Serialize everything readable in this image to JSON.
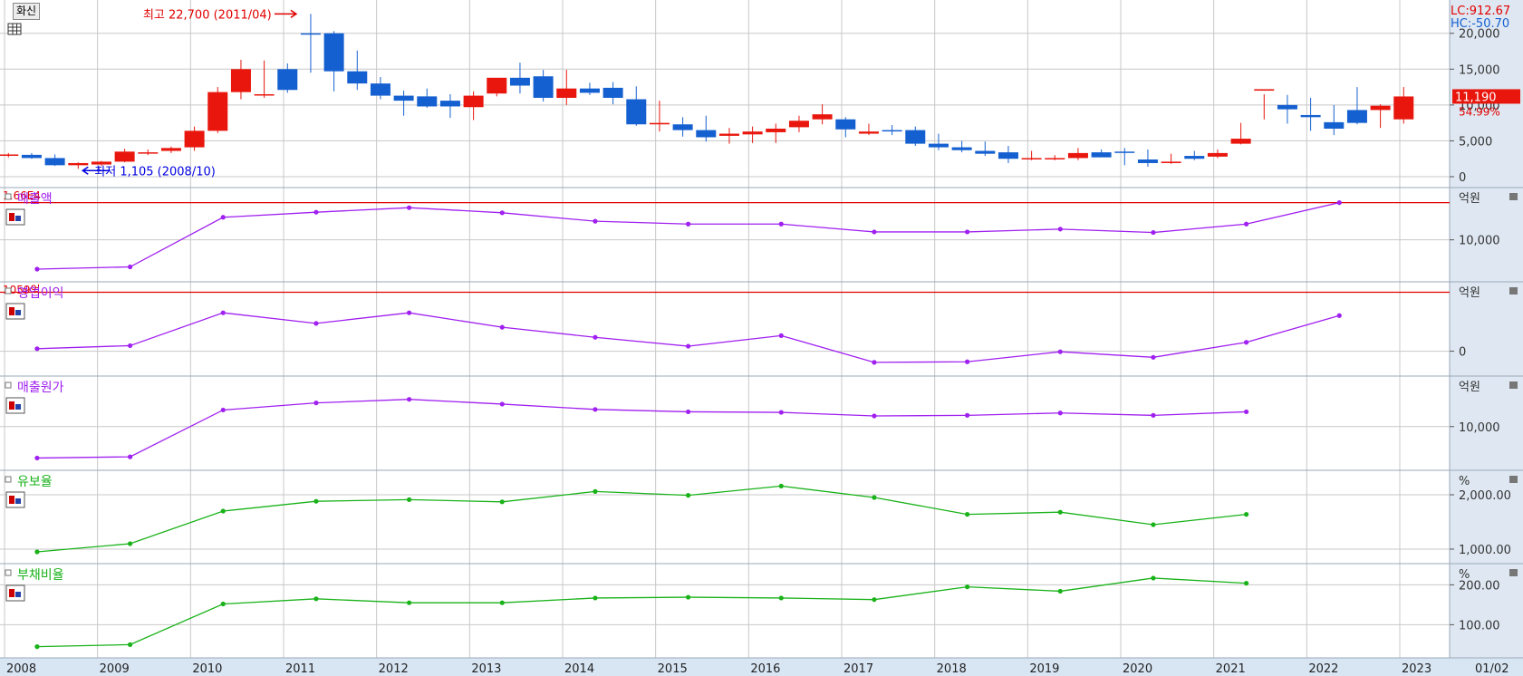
{
  "toolbar": {
    "title": "화신"
  },
  "x_axis": {
    "labels": [
      "2008",
      "2009",
      "2010",
      "2011",
      "2012",
      "2013",
      "2014",
      "2015",
      "2016",
      "2017",
      "2018",
      "2019",
      "2020",
      "2021",
      "2022",
      "2023"
    ],
    "end_label": "01/02"
  },
  "price_panel": {
    "lc_label": "LC:912.67",
    "hc_label": "HC:-50.70",
    "high_annotation": "최고 22,700 (2011/04)",
    "low_annotation": "최저 1,105 (2008/10)",
    "current_price": "11,190",
    "current_pct": "54.99%",
    "y_ticks": [
      "20,000",
      "15,000",
      "10,000",
      "5,000",
      "0"
    ]
  },
  "panels": [
    {
      "id": "sales",
      "title": "매출액",
      "unit": "억원",
      "ref_label": "1.66E4",
      "ticks": [
        "10,000"
      ],
      "color": "#a020f0"
    },
    {
      "id": "op_income",
      "title": "영업이익",
      "unit": "억원",
      "ref_label": "1059억",
      "ticks": [
        "0"
      ],
      "color": "#a020f0"
    },
    {
      "id": "cogs",
      "title": "매출원가",
      "unit": "억원",
      "ticks": [
        "10,000"
      ],
      "color": "#a020f0"
    },
    {
      "id": "retention",
      "title": "유보율",
      "unit": "%",
      "ticks": [
        "2,000.00",
        "1,000.00"
      ],
      "color": "#19b219"
    },
    {
      "id": "debt",
      "title": "부채비율",
      "unit": "%",
      "ticks": [
        "200.00",
        "100.00"
      ],
      "color": "#19b219"
    }
  ],
  "colors": {
    "up": "#e8160c",
    "down": "#1560d0",
    "grid": "#c8c8c8",
    "axis_bg": "#d8e6f4",
    "ref_line": "#e00000",
    "purple": "#a020f0",
    "green": "#19b219"
  },
  "chart_data": [
    {
      "type": "candlestick",
      "title": "",
      "x": [
        "2008-01",
        "2008-04",
        "2008-07",
        "2008-10",
        "2009-01",
        "2009-04",
        "2009-07",
        "2009-10",
        "2010-01",
        "2010-04",
        "2010-07",
        "2010-10",
        "2011-01",
        "2011-04",
        "2011-07",
        "2011-10",
        "2012-01",
        "2012-04",
        "2012-07",
        "2012-10",
        "2013-01",
        "2013-04",
        "2013-07",
        "2013-10",
        "2014-01",
        "2014-04",
        "2014-07",
        "2014-10",
        "2015-01",
        "2015-04",
        "2015-07",
        "2015-10",
        "2016-01",
        "2016-04",
        "2016-07",
        "2016-10",
        "2017-01",
        "2017-04",
        "2017-07",
        "2017-10",
        "2018-01",
        "2018-04",
        "2018-07",
        "2018-10",
        "2019-01",
        "2019-04",
        "2019-07",
        "2019-10",
        "2020-01",
        "2020-04",
        "2020-07",
        "2020-10",
        "2021-01",
        "2021-04",
        "2021-07",
        "2021-10",
        "2022-01",
        "2022-04",
        "2022-07",
        "2022-10",
        "2023-01"
      ],
      "open": [
        2950,
        3050,
        2600,
        1600,
        1700,
        2100,
        3300,
        3600,
        4100,
        6400,
        11800,
        11500,
        15000,
        20000,
        20000,
        14700,
        13000,
        11300,
        11200,
        10600,
        9700,
        11600,
        13800,
        14000,
        11000,
        12300,
        12400,
        10800,
        7300,
        7300,
        6500,
        5700,
        5900,
        6200,
        6900,
        8000,
        8000,
        6000,
        6500,
        6500,
        4600,
        4100,
        3600,
        3400,
        2600,
        2500,
        2600,
        3400,
        3500,
        2400,
        1900,
        2900,
        2800,
        4600,
        12000,
        10000,
        8600,
        7600,
        9300,
        9300,
        8000
      ],
      "high": [
        3300,
        3300,
        3100,
        2000,
        2200,
        3900,
        3800,
        4200,
        7000,
        12500,
        16300,
        16200,
        15800,
        22700,
        20300,
        17600,
        13900,
        12000,
        12300,
        11500,
        11900,
        13100,
        15900,
        14900,
        14900,
        13100,
        13200,
        12600,
        10600,
        8300,
        8500,
        6800,
        7000,
        7400,
        8500,
        10100,
        8300,
        7400,
        7200,
        7000,
        6000,
        5000,
        4900,
        4300,
        3600,
        3000,
        4000,
        3800,
        4000,
        3800,
        3200,
        3600,
        3800,
        7500,
        11500,
        11400,
        11000,
        10000,
        12500,
        10100,
        12500
      ],
      "low": [
        2700,
        2500,
        1500,
        1105,
        1500,
        2000,
        3000,
        3300,
        3600,
        6100,
        10800,
        11000,
        11700,
        14500,
        11900,
        12100,
        10800,
        8500,
        9600,
        8200,
        7900,
        11200,
        11600,
        10500,
        10000,
        11400,
        10100,
        7100,
        6300,
        5600,
        4900,
        4600,
        4700,
        4700,
        6200,
        7300,
        5500,
        5800,
        5800,
        4300,
        3700,
        3400,
        2900,
        1900,
        2300,
        2300,
        2300,
        2800,
        1600,
        1400,
        1800,
        2300,
        2600,
        4500,
        8000,
        7400,
        6400,
        5800,
        7300,
        6800,
        7400
      ],
      "close": [
        3100,
        2600,
        1600,
        1900,
        2100,
        3500,
        3400,
        4000,
        6400,
        11800,
        15000,
        11500,
        12100,
        19900,
        14700,
        13000,
        11300,
        10600,
        9800,
        9800,
        11300,
        13800,
        12700,
        11000,
        12300,
        11700,
        11000,
        7300,
        7500,
        6500,
        5500,
        6000,
        6300,
        6700,
        7800,
        8700,
        6600,
        6300,
        6400,
        4600,
        4100,
        3700,
        3200,
        2500,
        2600,
        2600,
        3300,
        2700,
        3400,
        1900,
        2100,
        2500,
        3300,
        5300,
        12200,
        9400,
        8300,
        6700,
        7500,
        9900,
        11190
      ]
    },
    {
      "type": "line",
      "title": "매출액",
      "x": [
        "2008",
        "2009",
        "2010",
        "2011",
        "2012",
        "2013",
        "2014",
        "2015",
        "2016",
        "2017",
        "2018",
        "2019",
        "2020",
        "2021",
        "2022"
      ],
      "y": [
        4800,
        5200,
        14000,
        14900,
        15700,
        14800,
        13300,
        12800,
        12800,
        11400,
        11400,
        11900,
        11300,
        12800,
        16600
      ],
      "ylabel": "억원",
      "ref_line": 16600
    },
    {
      "type": "line",
      "title": "영업이익",
      "x": [
        "2008",
        "2009",
        "2010",
        "2011",
        "2012",
        "2013",
        "2014",
        "2015",
        "2016",
        "2017",
        "2018",
        "2019",
        "2020",
        "2021",
        "2022"
      ],
      "y": [
        45,
        100,
        690,
        500,
        690,
        430,
        250,
        90,
        280,
        -200,
        -190,
        -10,
        -110,
        160,
        640
      ],
      "ylabel": "억원",
      "ref_line": 1059
    },
    {
      "type": "line",
      "title": "매출원가",
      "x": [
        "2008",
        "2009",
        "2010",
        "2011",
        "2012",
        "2013",
        "2014",
        "2015",
        "2016",
        "2017",
        "2018",
        "2019",
        "2020",
        "2021"
      ],
      "y": [
        4700,
        4900,
        12800,
        14000,
        14600,
        13800,
        12900,
        12500,
        12400,
        11800,
        11900,
        12300,
        11900,
        12500
      ],
      "ylabel": "억원"
    },
    {
      "type": "line",
      "title": "유보율",
      "x": [
        "2008",
        "2009",
        "2010",
        "2011",
        "2012",
        "2013",
        "2014",
        "2015",
        "2016",
        "2017",
        "2018",
        "2019",
        "2020",
        "2021"
      ],
      "y": [
        950,
        1100,
        1700,
        1880,
        1910,
        1870,
        2060,
        1990,
        2160,
        1950,
        1640,
        1680,
        1450,
        1640
      ],
      "ylabel": "%"
    },
    {
      "type": "line",
      "title": "부채비율",
      "x": [
        "2008",
        "2009",
        "2010",
        "2011",
        "2012",
        "2013",
        "2014",
        "2015",
        "2016",
        "2017",
        "2018",
        "2019",
        "2020",
        "2021"
      ],
      "y": [
        45,
        50,
        152,
        165,
        155,
        155,
        167,
        169,
        167,
        163,
        195,
        184,
        217,
        204
      ],
      "ylabel": "%"
    }
  ]
}
